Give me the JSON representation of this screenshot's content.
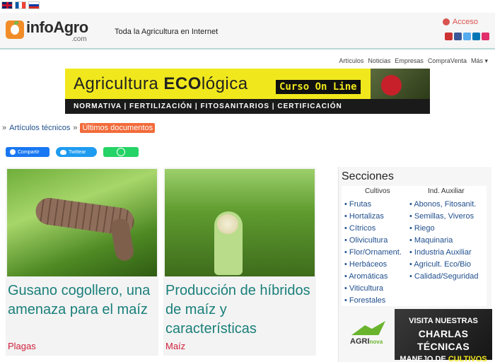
{
  "header": {
    "brand": "infoAgro",
    "brand_suffix": ".com",
    "tagline": "Toda la Agricultura en Internet",
    "login_label": "Acceso",
    "languages": [
      "en",
      "fr",
      "ru"
    ],
    "social_icons": [
      "youtube-icon",
      "facebook-icon",
      "twitter-icon",
      "linkedin-icon",
      "instagram-icon"
    ]
  },
  "nav": {
    "items": [
      "Artículos",
      "Noticias",
      "Empresas",
      "CompraVenta",
      "Más ▾"
    ]
  },
  "banner": {
    "title_prefix": "Agricultura ",
    "title_bold": "ECO",
    "title_suffix": "lógica",
    "course_label": "Curso On Line",
    "topics": "NORMATIVA | FERTILIZACIÓN | FITOSANITARIOS | CERTIFICACIÓN"
  },
  "breadcrumb": {
    "prefix": "»",
    "link": "Artículos técnicos",
    "separator": "»",
    "current": "Últimos documentos"
  },
  "share": {
    "facebook_label": "Compartir",
    "twitter_label": "Twittear"
  },
  "articles": [
    {
      "title": "Gusano cogollero, una amenaza para el maíz",
      "category": "Plagas"
    },
    {
      "title": "Producción de híbridos de maíz y características",
      "category": "Maíz"
    }
  ],
  "sidebar": {
    "title": "Secciones",
    "cultivos_header": "Cultivos",
    "auxiliar_header": "Ind. Auxiliar",
    "cultivos": [
      "Frutas",
      "Hortalizas",
      "Cítricos",
      "Olivicultura",
      "Flor/Ornament.",
      "Herbáceos",
      "Aromáticas",
      "Viticultura",
      "Forestales"
    ],
    "auxiliar": [
      "Abonos, Fitosanit.",
      "Semillas, Viveros",
      "Riego",
      "Maquinaria",
      "Industria Auxiliar",
      "Agricult. Eco/Bio",
      "Calidad/Seguridad"
    ],
    "agrinova_text": "AGRI",
    "agrinova_suffix": "nova",
    "charlas_line1": "VISITA NUESTRAS",
    "charlas_line2": "CHARLAS TÉCNICAS",
    "charlas_line3a": "MANEJO DE ",
    "charlas_line3b": "CULTIVOS"
  }
}
